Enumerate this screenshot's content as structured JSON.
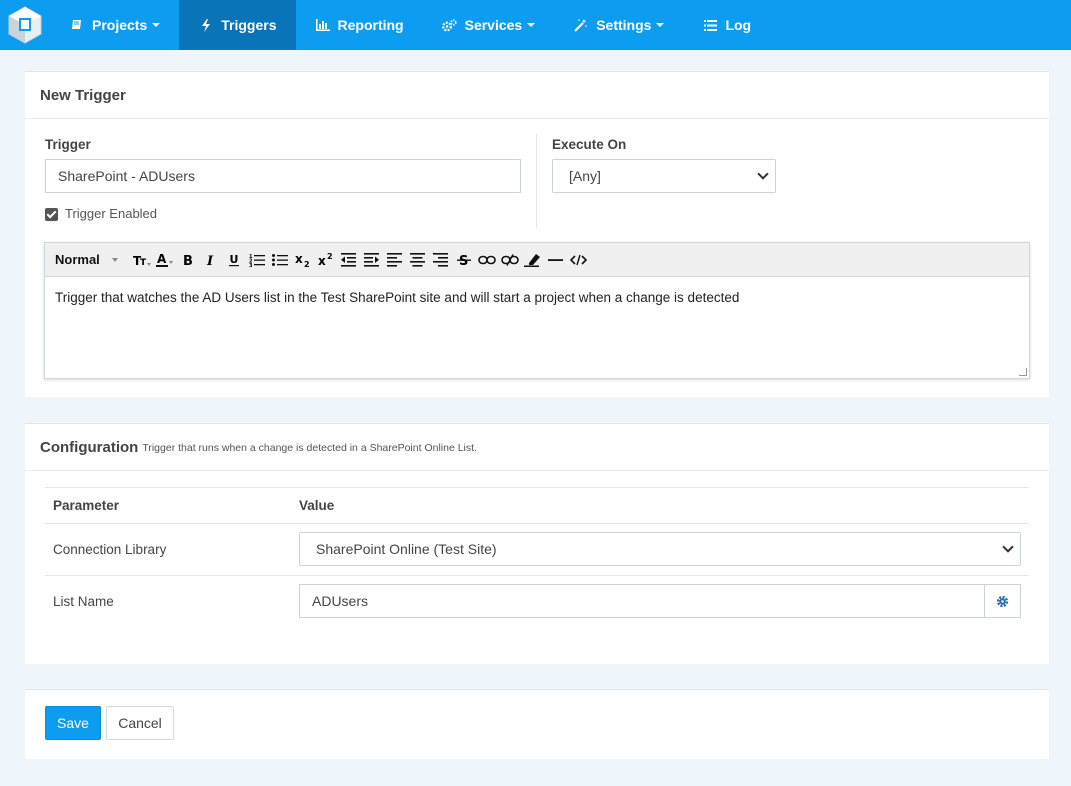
{
  "nav": {
    "items": [
      {
        "label": "Projects",
        "icon": "book-icon",
        "dropdown": true
      },
      {
        "label": "Triggers",
        "icon": "bolt-icon",
        "dropdown": false,
        "active": true
      },
      {
        "label": "Reporting",
        "icon": "bar-chart-icon",
        "dropdown": false
      },
      {
        "label": "Services",
        "icon": "cogs-icon",
        "dropdown": true
      },
      {
        "label": "Settings",
        "icon": "magic-wand-icon",
        "dropdown": true
      },
      {
        "label": "Log",
        "icon": "list-icon",
        "dropdown": false
      }
    ],
    "accent": "#0d9df0",
    "active_bg": "#0a74b8"
  },
  "new_trigger": {
    "title": "New Trigger",
    "trigger_label": "Trigger",
    "trigger_value": "SharePoint - ADUsers",
    "enabled_label": "Trigger Enabled",
    "enabled": true,
    "execute_on_label": "Execute On",
    "execute_on_value": "[Any]",
    "editor": {
      "format_label": "Normal",
      "content": "Trigger that watches the AD Users list in the Test SharePoint site and will start a project when a change is detected"
    }
  },
  "configuration": {
    "title": "Configuration",
    "subtitle": "Trigger that runs when a change is detected in a SharePoint Online List.",
    "headers": {
      "parameter": "Parameter",
      "value": "Value"
    },
    "rows": [
      {
        "parameter": "Connection Library",
        "value": "SharePoint Online (Test Site)",
        "kind": "select"
      },
      {
        "parameter": "List Name",
        "value": "ADUsers",
        "kind": "text"
      }
    ]
  },
  "actions": {
    "save_label": "Save",
    "cancel_label": "Cancel"
  }
}
